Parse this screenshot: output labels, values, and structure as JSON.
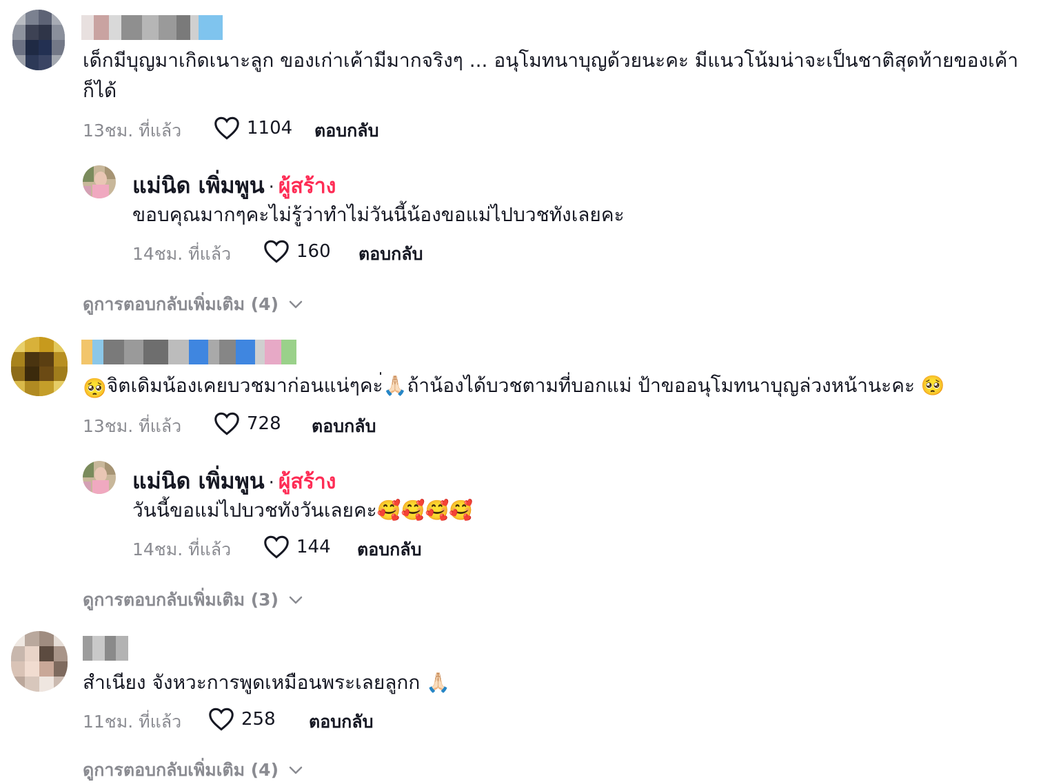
{
  "comments": [
    {
      "text": "เด็กมีบุญมาเกิดเนาะลูก ของเก่าเค้ามีมากจริงๆ ... อนุโมทนาบุญด้วยนะคะ มีแนวโน้มน่าจะเป็นชาติสุดท้ายของเค้าก็ได้",
      "time": "13ชม. ที่แล้ว",
      "likes": "1104",
      "reply_label": "ตอบกลับ",
      "creator_reply": {
        "name": "แม่นิด เพิ่มพูน",
        "separator": "·",
        "badge": "ผู้สร้าง",
        "text": "ขอบคุณมากๆคะไม่รู้ว่าทำไม่วันนี้น้องขอแม่ไปบวชทังเลยคะ",
        "time": "14ชม. ที่แล้ว",
        "likes": "160",
        "reply_label": "ตอบกลับ"
      },
      "view_more": "ดูการตอบกลับเพิ่มเติม (4)"
    },
    {
      "text_prefix": "🥺",
      "text_main": "จิตเดิมน้องเคยบวชมาก่อนแน่ๆคะ่🙏🏻ถ้าน้องได้บวชตามที่บอกแม่ ป้าขออนุโมทนาบุญล่วงหน้านะคะ 🥺",
      "time": "13ชม. ที่แล้ว",
      "likes": "728",
      "reply_label": "ตอบกลับ",
      "creator_reply": {
        "name": "แม่นิด เพิ่มพูน",
        "separator": "·",
        "badge": "ผู้สร้าง",
        "text": "วันนี้ขอแม่ไปบวชทังวันเลยคะ🥰🥰🥰🥰",
        "time": "14ชม. ที่แล้ว",
        "likes": "144",
        "reply_label": "ตอบกลับ"
      },
      "view_more": "ดูการตอบกลับเพิ่มเติม (3)"
    },
    {
      "text": "สำเนียง จังหวะการพูดเหมือนพระเลยลูกก 🙏🏻",
      "time": "11ชม. ที่แล้ว",
      "likes": "258",
      "reply_label": "ตอบกลับ",
      "view_more": "ดูการตอบกลับเพิ่มเติม (4)"
    }
  ],
  "colors": {
    "creator_badge": "#fe2c55",
    "secondary_text": "#8a8b91",
    "primary_text": "#161823"
  },
  "icons": {
    "like": "heart-outline-icon",
    "expand": "chevron-down-icon"
  }
}
